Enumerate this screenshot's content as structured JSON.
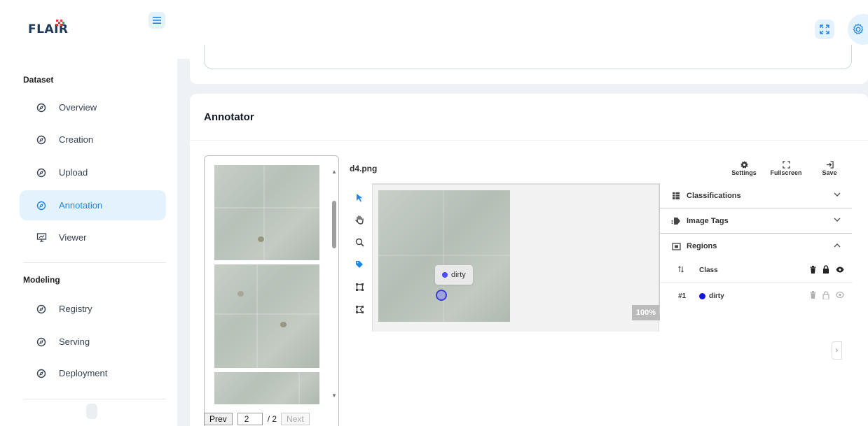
{
  "app": {
    "logo_text": "FLAIR"
  },
  "sidebar": {
    "sections": [
      {
        "title": "Dataset",
        "items": [
          {
            "label": "Overview",
            "active": false
          },
          {
            "label": "Creation",
            "active": false
          },
          {
            "label": "Upload",
            "active": false
          },
          {
            "label": "Annotation",
            "active": true
          },
          {
            "label": "Viewer",
            "active": false
          }
        ]
      },
      {
        "title": "Modeling",
        "items": [
          {
            "label": "Registry",
            "active": false
          },
          {
            "label": "Serving",
            "active": false
          },
          {
            "label": "Deployment",
            "active": false
          }
        ]
      }
    ]
  },
  "main": {
    "card_title": "Annotator"
  },
  "thumbnails": {
    "pager": {
      "prev_label": "Prev",
      "page_value": "2",
      "total_label": "/ 2",
      "next_label": "Next"
    }
  },
  "annotator": {
    "filename": "d4.png",
    "top_tools": [
      {
        "label": "Settings",
        "icon": "gear-icon"
      },
      {
        "label": "Fullscreen",
        "icon": "fullscreen-icon"
      },
      {
        "label": "Save",
        "icon": "save-exit-icon"
      }
    ],
    "left_tools": [
      "pointer-icon",
      "hand-icon",
      "zoom-icon",
      "tag-icon",
      "bounding-box-icon",
      "polygon-icon"
    ],
    "zoom_level": "100%",
    "region_label": "dirty",
    "region_color": "#1414e0"
  },
  "panels": {
    "classifications_title": "Classifications",
    "image_tags_title": "Image Tags",
    "regions_title": "Regions",
    "regions_header": {
      "class_label": "Class"
    },
    "regions_rows": [
      {
        "index": "#1",
        "class": "dirty"
      }
    ]
  },
  "colors": {
    "accent": "#1e88e5",
    "accent_bg": "#e3f2fd",
    "background": "#eef2f6"
  }
}
